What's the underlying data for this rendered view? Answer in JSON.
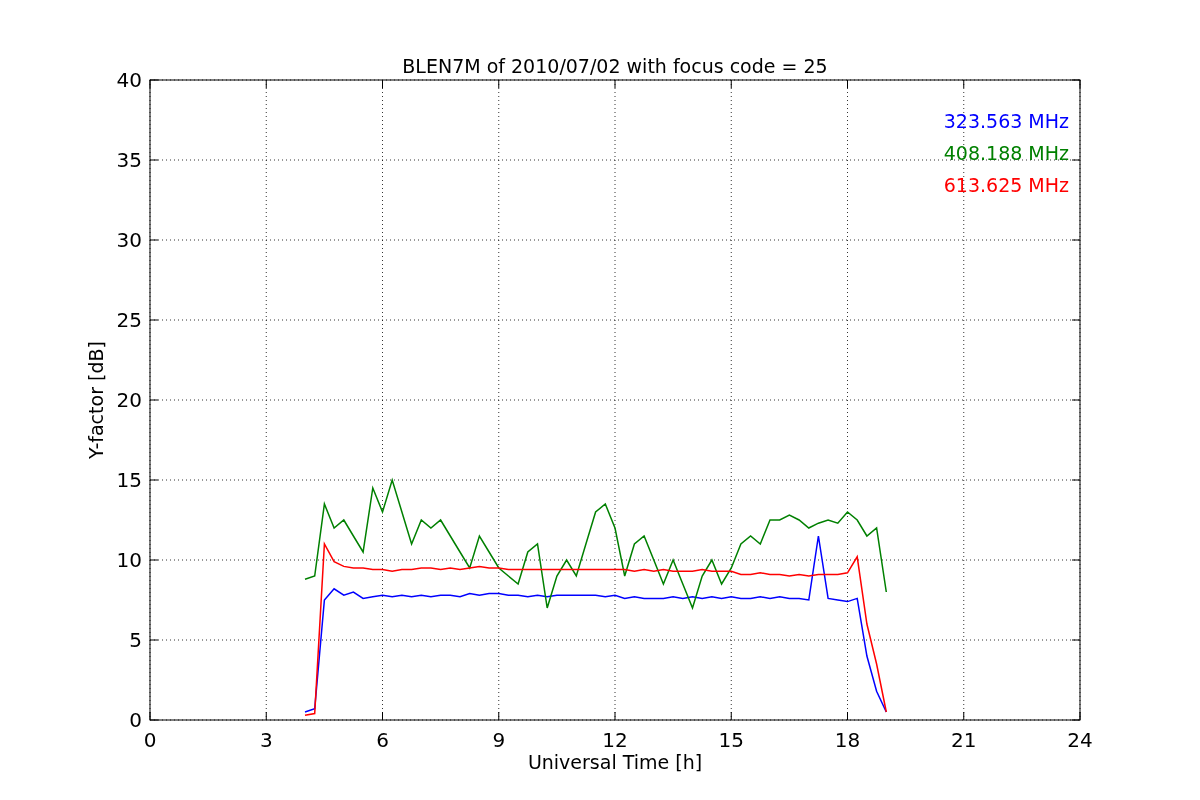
{
  "chart_data": {
    "type": "line",
    "title": "BLEN7M of 2010/07/02 with focus code = 25",
    "xlabel": "Universal Time [h]",
    "ylabel": "Y-factor [dB]",
    "x": [
      4,
      4.25,
      4.5,
      4.75,
      5,
      5.25,
      5.5,
      5.75,
      6,
      6.25,
      6.5,
      6.75,
      7,
      7.25,
      7.5,
      7.75,
      8,
      8.25,
      8.5,
      8.75,
      9,
      9.25,
      9.5,
      9.75,
      10,
      10.25,
      10.5,
      10.75,
      11,
      11.25,
      11.5,
      11.75,
      12,
      12.25,
      12.5,
      12.75,
      13,
      13.25,
      13.5,
      13.75,
      14,
      14.25,
      14.5,
      14.75,
      15,
      15.25,
      15.5,
      15.75,
      16,
      16.25,
      16.5,
      16.75,
      17,
      17.25,
      17.5,
      17.75,
      18,
      18.25,
      18.5,
      18.75,
      19
    ],
    "series": [
      {
        "name": "323.563 MHz",
        "color": "#0000ff",
        "values": [
          0.5,
          0.7,
          7.5,
          8.2,
          7.8,
          8,
          7.6,
          7.7,
          7.8,
          7.7,
          7.8,
          7.7,
          7.8,
          7.7,
          7.8,
          7.8,
          7.7,
          7.9,
          7.8,
          7.9,
          7.9,
          7.8,
          7.8,
          7.7,
          7.8,
          7.7,
          7.8,
          7.8,
          7.8,
          7.8,
          7.8,
          7.7,
          7.8,
          7.6,
          7.7,
          7.6,
          7.6,
          7.6,
          7.7,
          7.6,
          7.7,
          7.6,
          7.7,
          7.6,
          7.7,
          7.6,
          7.6,
          7.7,
          7.6,
          7.7,
          7.6,
          7.6,
          7.5,
          11.5,
          7.6,
          7.5,
          7.4,
          7.6,
          4,
          1.8,
          0.5
        ]
      },
      {
        "name": "408.188 MHz",
        "color": "#008000",
        "values": [
          8.8,
          9,
          13.5,
          12,
          12.5,
          11.5,
          10.5,
          14.5,
          13,
          15,
          13,
          11,
          12.5,
          12,
          12.5,
          11.5,
          10.5,
          9.5,
          11.5,
          10.5,
          9.5,
          9,
          8.5,
          10.5,
          11,
          7,
          9,
          10,
          9,
          11,
          13,
          13.5,
          12,
          9,
          11,
          11.5,
          10,
          8.5,
          10,
          8.5,
          7,
          9,
          10,
          8.5,
          9.5,
          11,
          11.5,
          11,
          12.5,
          12.5,
          12.8,
          12.5,
          12,
          12.3,
          12.5,
          12.3,
          13,
          12.5,
          11.5,
          12,
          8
        ]
      },
      {
        "name": "613.625 MHz",
        "color": "#ff0000",
        "values": [
          0.3,
          0.4,
          11,
          9.9,
          9.6,
          9.5,
          9.5,
          9.4,
          9.4,
          9.3,
          9.4,
          9.4,
          9.5,
          9.5,
          9.4,
          9.5,
          9.4,
          9.5,
          9.6,
          9.5,
          9.5,
          9.4,
          9.4,
          9.4,
          9.4,
          9.4,
          9.4,
          9.4,
          9.4,
          9.4,
          9.4,
          9.4,
          9.4,
          9.4,
          9.3,
          9.4,
          9.3,
          9.4,
          9.3,
          9.3,
          9.3,
          9.4,
          9.3,
          9.3,
          9.3,
          9.1,
          9.1,
          9.2,
          9.1,
          9.1,
          9.0,
          9.1,
          9.0,
          9.1,
          9.1,
          9.1,
          9.2,
          10.2,
          6,
          3.5,
          0.5
        ]
      }
    ],
    "grid": true,
    "xlim": [
      0,
      24
    ],
    "ylim": [
      0,
      40
    ],
    "xticks": [
      0,
      3,
      6,
      9,
      12,
      15,
      18,
      21,
      24
    ],
    "yticks": [
      0,
      5,
      10,
      15,
      20,
      25,
      30,
      35,
      40
    ]
  }
}
